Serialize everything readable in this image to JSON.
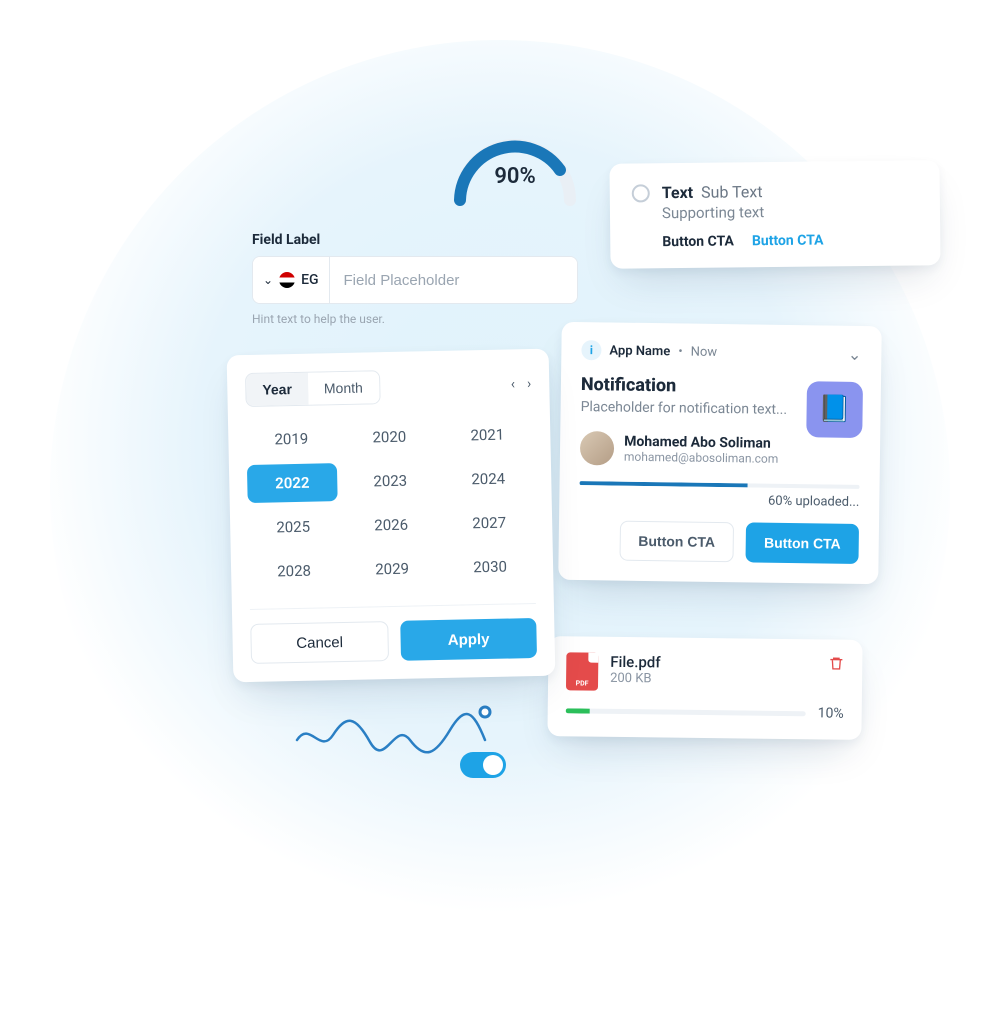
{
  "gauge": {
    "percent": 90,
    "label": "90%"
  },
  "text_card": {
    "title": "Text",
    "subtitle": "Sub Text",
    "supporting": "Supporting text",
    "button1": "Button CTA",
    "button2": "Button CTA"
  },
  "field": {
    "label": "Field Label",
    "country_code": "EG",
    "placeholder": "Field Placeholder",
    "hint": "Hint text to help the user."
  },
  "picker": {
    "tab_year": "Year",
    "tab_month": "Month",
    "years": [
      "2019",
      "2020",
      "2021",
      "2022",
      "2023",
      "2024",
      "2025",
      "2026",
      "2027",
      "2028",
      "2029",
      "2030"
    ],
    "selected_year": "2022",
    "cancel": "Cancel",
    "apply": "Apply"
  },
  "notification": {
    "app_name": "App Name",
    "time": "Now",
    "title": "Notification",
    "body": "Placeholder for notification text...",
    "user_name": "Mohamed Abo Soliman",
    "user_email": "mohamed@abosoliman.com",
    "progress_percent": 60,
    "progress_label": "60% uploaded...",
    "button1": "Button CTA",
    "button2": "Button CTA"
  },
  "file": {
    "name": "File.pdf",
    "size": "200 KB",
    "progress_percent": 10,
    "progress_label": "10%"
  },
  "toggle": {
    "on": true
  }
}
